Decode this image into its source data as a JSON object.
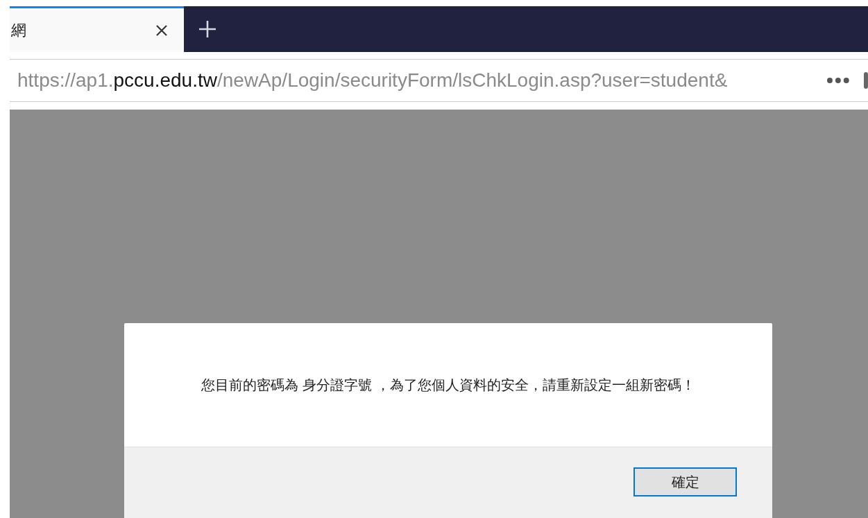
{
  "tab": {
    "title": "網",
    "selected": true
  },
  "address_bar": {
    "scheme": "https://ap1.",
    "host": "pccu.edu.tw",
    "path": "/newAp/Login/securityForm/lsChkLogin.asp?user=student&"
  },
  "dialog": {
    "message": "您目前的密碼為 身分證字號 ，為了您個人資料的安全，請重新設定一組新密碼！",
    "buttons": [
      {
        "label": "確定",
        "focused": true
      }
    ]
  }
}
